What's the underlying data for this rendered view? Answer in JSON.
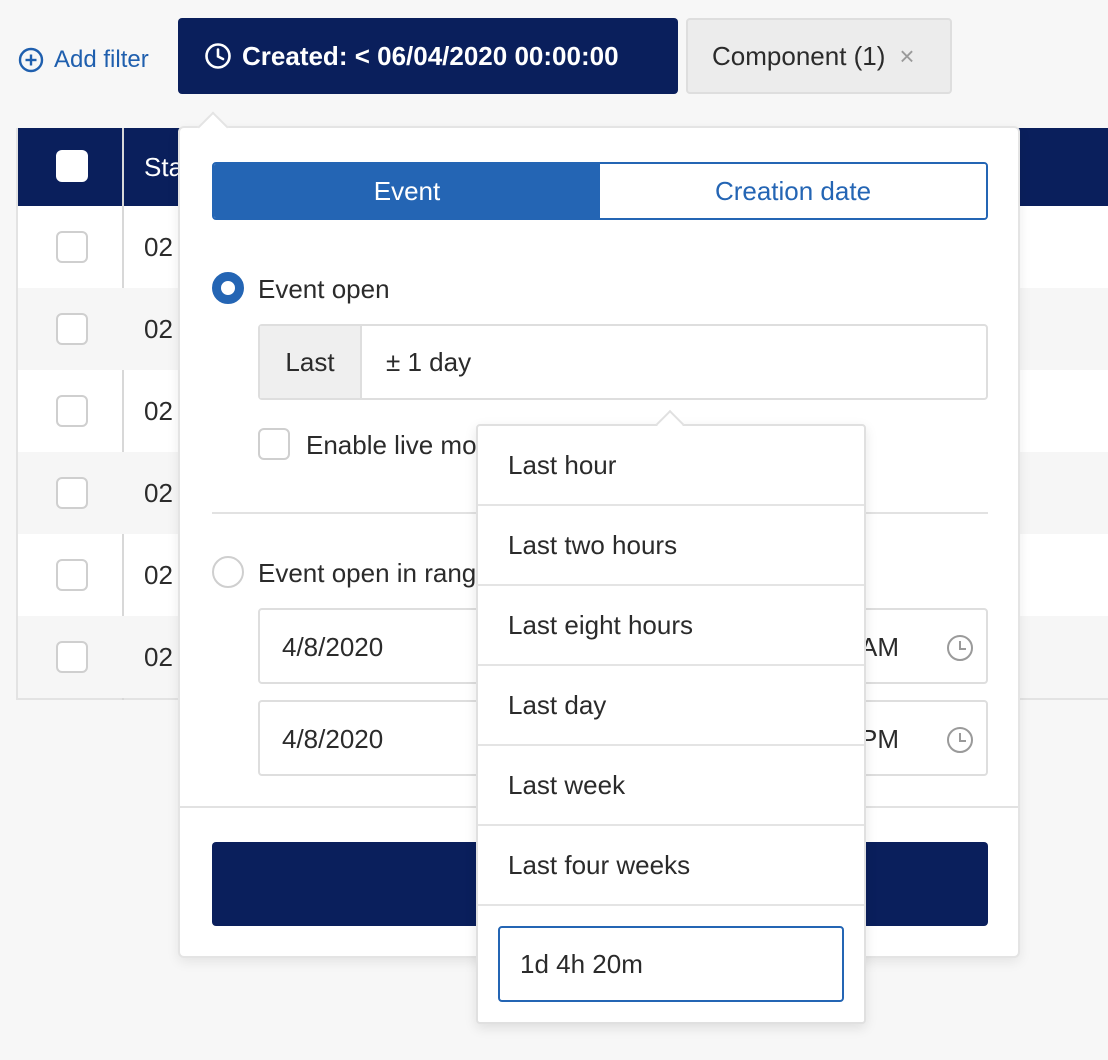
{
  "filter_bar": {
    "add_filter_label": "Add filter",
    "created_chip_label": "Created: < 06/04/2020 00:00:00",
    "component_chip_label": "Component (1)",
    "component_chip_remove": "×"
  },
  "table": {
    "header_status": "Sta",
    "rows": [
      "02",
      "02",
      "02",
      "02",
      "02",
      "02"
    ]
  },
  "popover": {
    "tabs": {
      "event": "Event",
      "creation_date": "Creation date",
      "active": "Event"
    },
    "option_event_open": "Event open",
    "last_prefix": "Last",
    "last_value": "± 1 day",
    "enable_live_label": "Enable live mo",
    "option_range": "Event open in rang",
    "range_start": {
      "date": "4/8/2020",
      "ampm": "AM"
    },
    "range_end": {
      "date": "4/8/2020",
      "ampm": "PM"
    }
  },
  "dropdown": {
    "items": [
      "Last hour",
      "Last two hours",
      "Last eight hours",
      "Last day",
      "Last week",
      "Last four weeks"
    ],
    "custom_value": "1d 4h 20m"
  },
  "colors": {
    "navy": "#0a1f5c",
    "accent_blue": "#2465b4"
  },
  "icons": {
    "add_filter": "plus-circle-icon",
    "created_chip": "clock-icon",
    "time_field": "clock-icon",
    "remove": "close-icon"
  }
}
